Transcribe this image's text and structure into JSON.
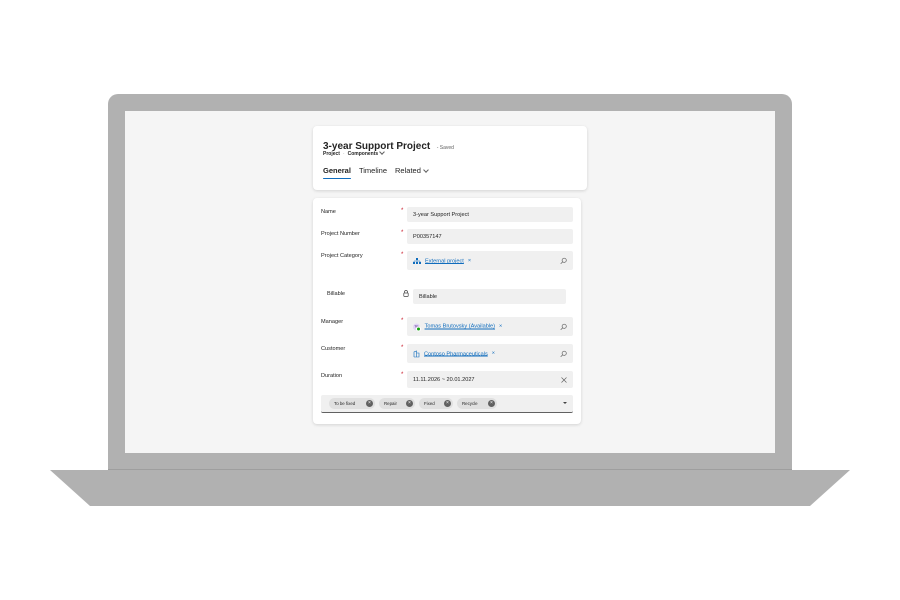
{
  "header": {
    "title": "3-year Support Project",
    "saved_status": "- Saved",
    "entity": "Project",
    "separator": "·",
    "form_selector": "Components",
    "tabs": [
      {
        "label": "General",
        "active": true
      },
      {
        "label": "Timeline",
        "active": false
      },
      {
        "label": "Related",
        "active": false
      }
    ]
  },
  "form": {
    "name": {
      "label": "Name",
      "required": "*",
      "value": "3-year Support Project"
    },
    "project_number": {
      "label": "Project Number",
      "required": "*",
      "value": "P00357147"
    },
    "project_category": {
      "label": "Project Category",
      "required": "*",
      "value": "External project",
      "icon": "org-chart-icon"
    },
    "billable": {
      "label": "Billable",
      "value": "Billable",
      "icon": "lock-icon"
    },
    "manager": {
      "label": "Manager",
      "required": "*",
      "value": "Tomas Brutovsky (Available)",
      "initials": "TB"
    },
    "customer": {
      "label": "Customer",
      "required": "*",
      "value": "Contoso Pharmaceuticals",
      "icon": "building-icon"
    },
    "duration": {
      "label": "Duration",
      "required": "*",
      "value": "11.11.2026 ~ 20.01.2027"
    },
    "tags": [
      "To be fixed",
      "Repair",
      "Fixed",
      "Recycle"
    ]
  },
  "colors": {
    "accent": "#0f6cbd",
    "required": "#c50f1f",
    "laptop_frame": "#b1b1b1",
    "presence_available": "#13a10e"
  },
  "icons": {
    "remove": "×",
    "chip_remove": "×"
  }
}
